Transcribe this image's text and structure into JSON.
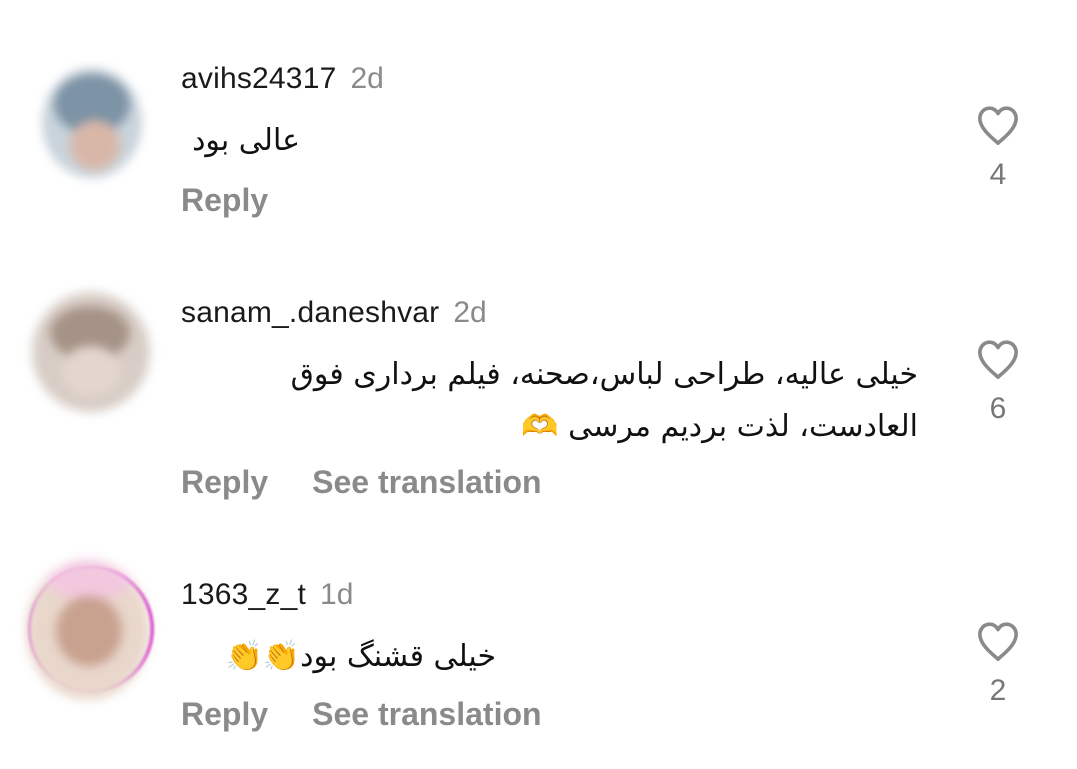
{
  "comments": [
    {
      "username": "avihs24317",
      "time": "2d",
      "text": "عالی بود",
      "reply_label": "Reply",
      "likes": "4"
    },
    {
      "username": "sanam_.daneshvar",
      "time": "2d",
      "text_line1": "خیلی عالیه، طراحی لباس،صحنه، فیلم برداری فوق",
      "text_line2": "العادست، لذت بردیم مرسی 🫶",
      "reply_label": "Reply",
      "translate_label": "See translation",
      "likes": "6"
    },
    {
      "username": "1363_z_t",
      "time": "1d",
      "text": "خیلی قشنگ بود👏👏",
      "reply_label": "Reply",
      "translate_label": "See translation",
      "likes": "2"
    }
  ],
  "colors": {
    "username": "#1a1a1a",
    "meta_gray": "#8a8a8a",
    "story_ring": "#d62bd6"
  },
  "icons": {
    "like": "heart-outline-icon"
  }
}
